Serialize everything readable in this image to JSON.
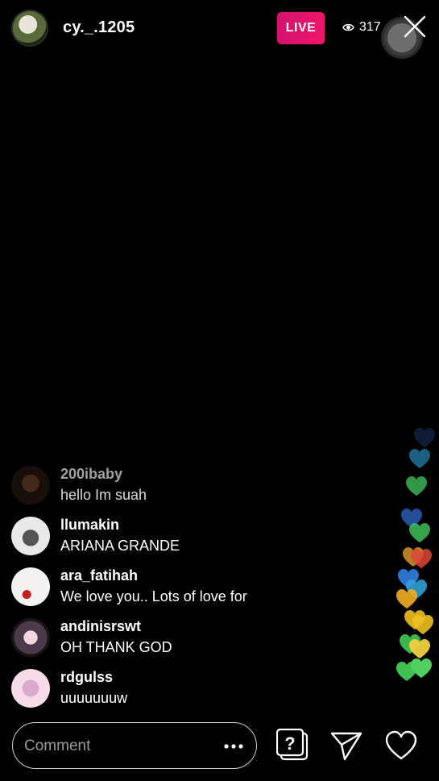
{
  "header": {
    "host_name": "cy._.1205",
    "live_label": "LIVE",
    "viewer_count": "317"
  },
  "comments": [
    {
      "user": "200ibaby",
      "text": "hello Im suah"
    },
    {
      "user": "llumakin",
      "text": "ARIANA GRANDE"
    },
    {
      "user": "ara_fatihah",
      "text": "We love you.. Lots of love for"
    },
    {
      "user": "andinisrswt",
      "text": "OH THANK GOD"
    },
    {
      "user": "rdgulss",
      "text": "uuuuuuuw"
    }
  ],
  "footer": {
    "comment_placeholder": "Comment"
  },
  "colors": {
    "live": "#e8146b",
    "background": "#000000"
  },
  "icons": [
    "eye-icon",
    "close-icon",
    "more-icon",
    "question-icon",
    "send-icon",
    "heart-icon"
  ]
}
